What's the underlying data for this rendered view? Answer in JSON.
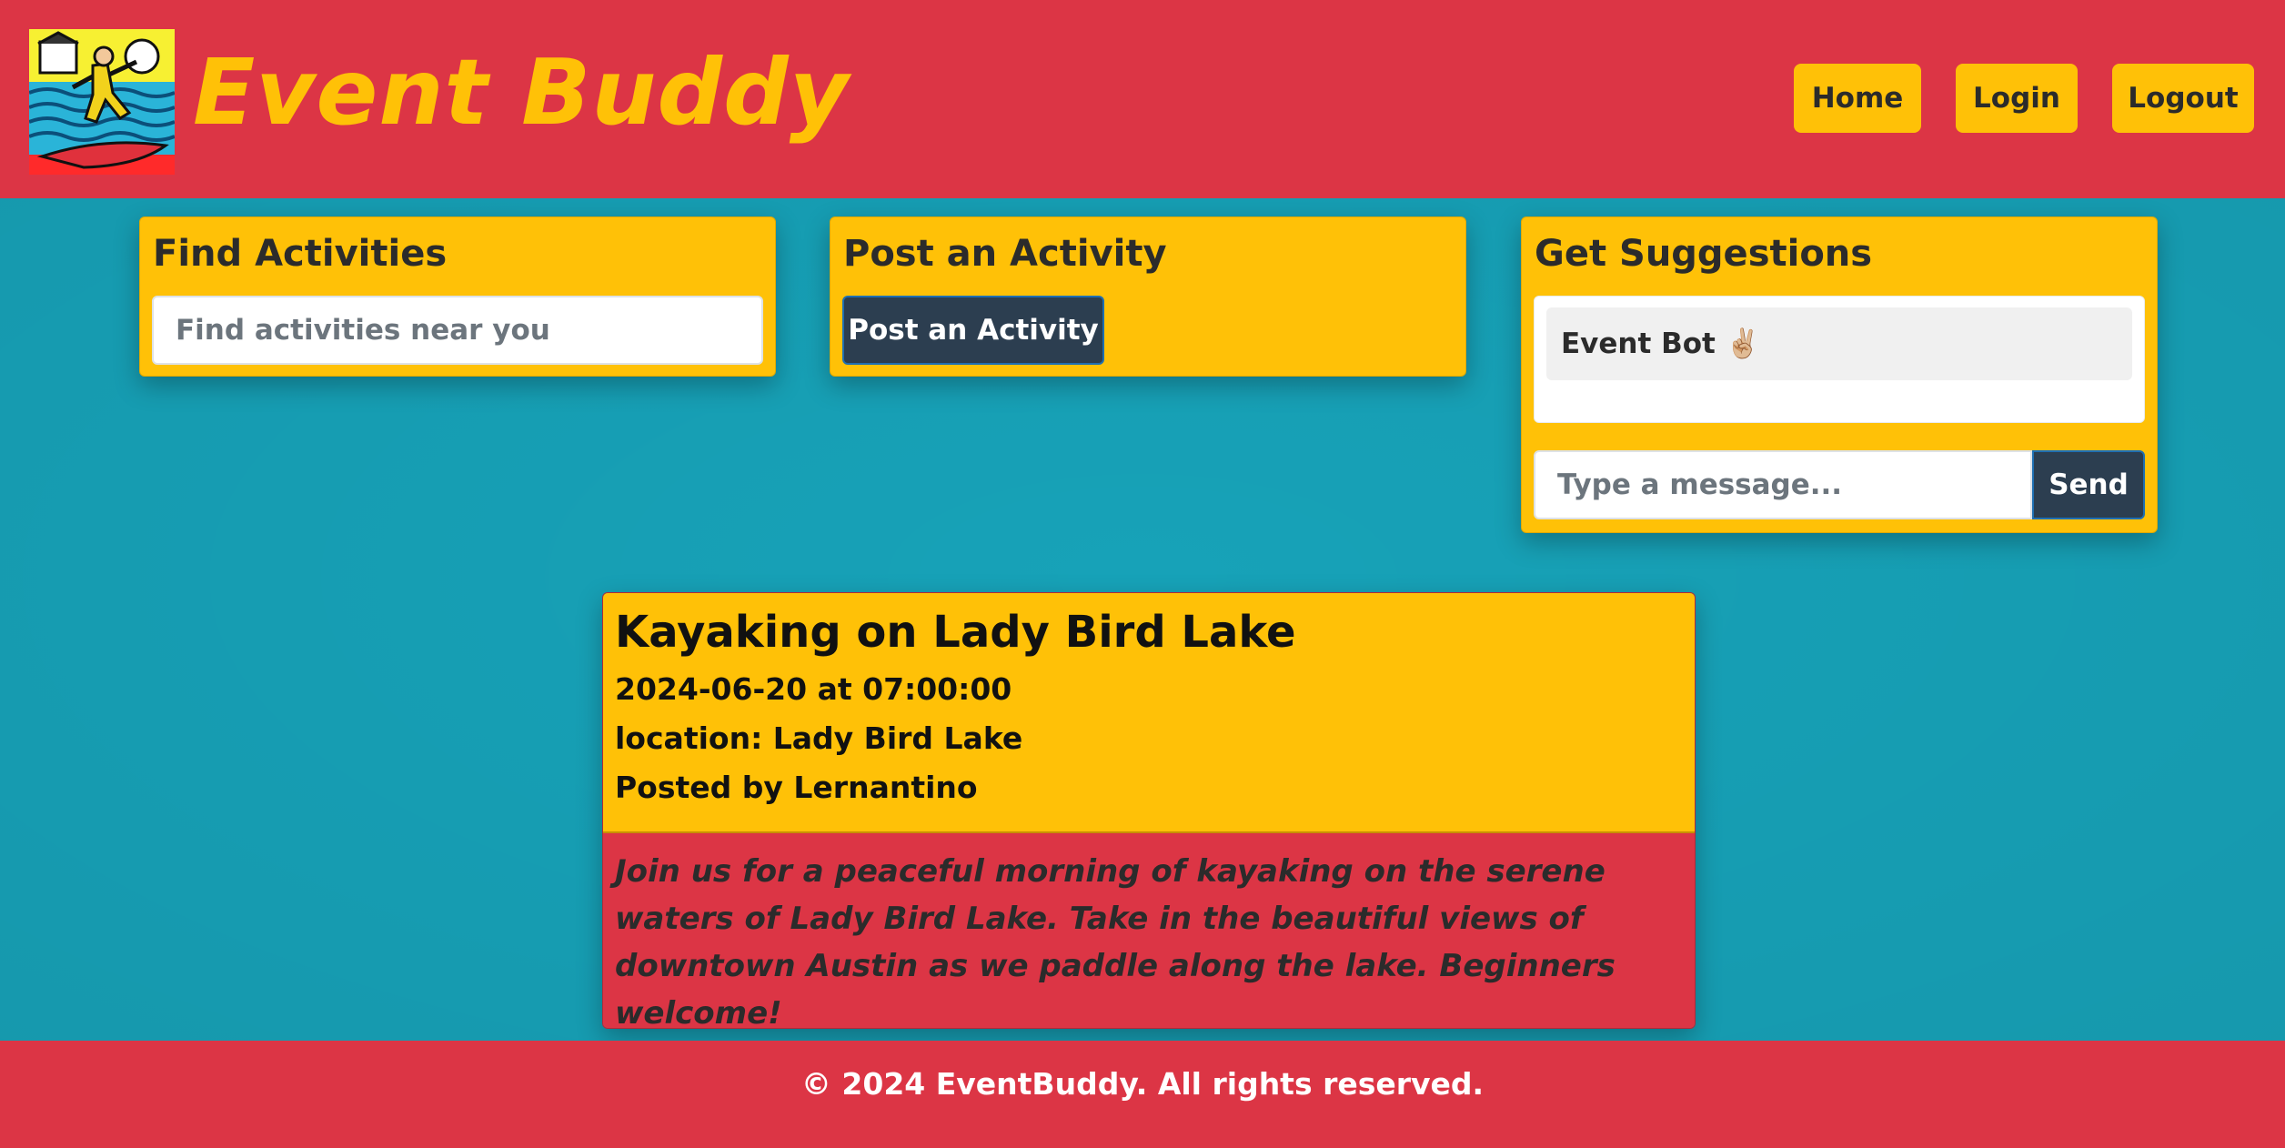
{
  "header": {
    "app_title": "Event Buddy",
    "logo_icon": "surfer-comic-art-icon",
    "nav": {
      "home_label": "Home",
      "login_label": "Login",
      "logout_label": "Logout"
    }
  },
  "find": {
    "title": "Find Activities",
    "search_placeholder": "Find activities near you"
  },
  "post": {
    "title": "Post an Activity",
    "button_label": "Post an Activity"
  },
  "suggest": {
    "title": "Get Suggestions",
    "bot_message": "Event Bot ✌🏼",
    "message_placeholder": "Type a message...",
    "send_label": "Send"
  },
  "activity": {
    "title": "Kayaking on Lady Bird Lake",
    "datetime": "2024-06-20 at 07:00:00",
    "location": "location: Lady Bird Lake",
    "posted_by": "Posted by Lernantino",
    "description": "Join us for a peaceful morning of kayaking on the serene waters of Lady Bird Lake. Take in the beautiful views of downtown Austin as we paddle along the lake. Beginners welcome!"
  },
  "footer": {
    "text": "© 2024 EventBuddy. All rights reserved."
  },
  "colors": {
    "primary_red": "#dc3545",
    "accent_yellow": "#ffc107",
    "main_teal": "#17a2b8",
    "dark_button": "#2c3e50"
  }
}
